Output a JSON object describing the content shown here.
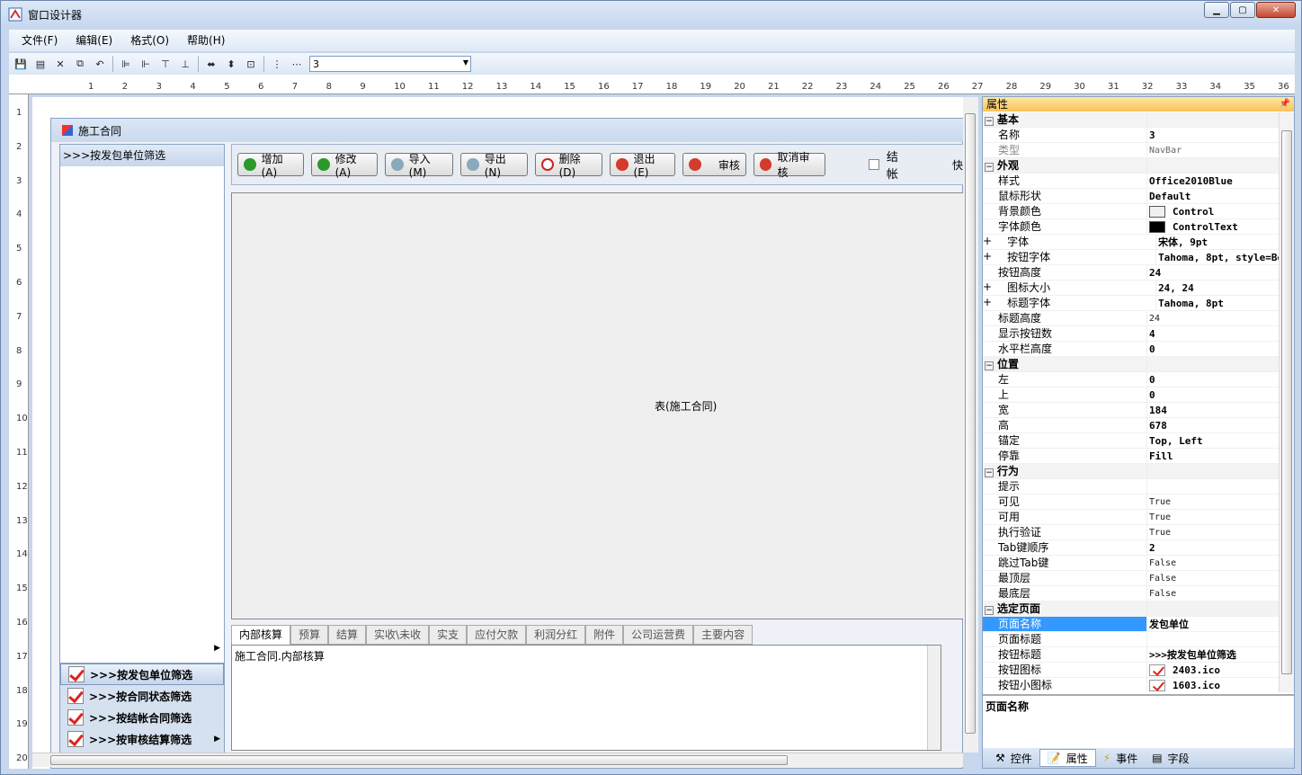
{
  "window": {
    "title": "窗口设计器"
  },
  "menu": [
    "文件(F)",
    "编辑(E)",
    "格式(O)",
    "帮助(H)"
  ],
  "toolbar": {
    "combo_value": "3"
  },
  "ruler": {
    "h": [
      "1",
      "2",
      "3",
      "4",
      "5",
      "6",
      "7",
      "8",
      "9",
      "10",
      "11",
      "12",
      "13",
      "14",
      "15",
      "16",
      "17",
      "18",
      "19",
      "20",
      "21",
      "22",
      "23",
      "24",
      "25",
      "26",
      "27",
      "28",
      "29",
      "30",
      "31",
      "32",
      "33",
      "34",
      "35",
      "36"
    ],
    "v": [
      "1",
      "2",
      "3",
      "4",
      "5",
      "6",
      "7",
      "8",
      "9",
      "10",
      "11",
      "12",
      "13",
      "14",
      "15",
      "16",
      "17",
      "18",
      "19",
      "20"
    ]
  },
  "form": {
    "title": "施工合同",
    "navbar": {
      "header": ">>>按发包单位筛选",
      "buttons": [
        ">>>按发包单位筛选",
        ">>>按合同状态筛选",
        ">>>按结帐合同筛选",
        ">>>按审核结算筛选"
      ]
    },
    "buttons": [
      {
        "label": "增加(A)",
        "icon": "check-icon"
      },
      {
        "label": "修改(A)",
        "icon": "check-icon"
      },
      {
        "label": "导入(M)",
        "icon": "import-icon"
      },
      {
        "label": "导出(N)",
        "icon": "export-icon"
      },
      {
        "label": "删除(D)",
        "icon": "delete-icon"
      },
      {
        "label": "退出(E)",
        "icon": "minus-icon"
      },
      {
        "label": "审核",
        "icon": "minus-icon"
      },
      {
        "label": "取消审核",
        "icon": "minus-icon"
      }
    ],
    "checkbox_label": "结帐",
    "cut_text": "快",
    "grid_label": "表(施工合同)",
    "tabs": [
      "内部核算",
      "预算",
      "结算",
      "实收\\未收",
      "实支",
      "应付欠款",
      "利润分红",
      "附件",
      "公司运营费",
      "主要内容"
    ],
    "tab_content": "施工合同.内部核算"
  },
  "properties": {
    "title": "属性",
    "rows": [
      {
        "cat": "基本"
      },
      {
        "k": "名称",
        "v": "3"
      },
      {
        "k": "类型",
        "v": "NavBar",
        "style": "grey"
      },
      {
        "cat": "外观"
      },
      {
        "k": "样式",
        "v": "Office2010Blue"
      },
      {
        "k": "鼠标形状",
        "v": "Default"
      },
      {
        "k": "背景颜色",
        "v": "Control",
        "swatch": "#f0f0f0"
      },
      {
        "k": "字体颜色",
        "v": "ControlText",
        "swatch": "#000000"
      },
      {
        "k": "字体",
        "v": "宋体, 9pt",
        "plus": true
      },
      {
        "k": "按钮字体",
        "v": "Tahoma, 8pt, style=Bo",
        "plus": true
      },
      {
        "k": "按钮高度",
        "v": "24"
      },
      {
        "k": "图标大小",
        "v": "24, 24",
        "plus": true
      },
      {
        "k": "标题字体",
        "v": "Tahoma, 8pt",
        "plus": true
      },
      {
        "k": "标题高度",
        "v": "24",
        "style": "n"
      },
      {
        "k": "显示按钮数",
        "v": "4"
      },
      {
        "k": "水平栏高度",
        "v": "0"
      },
      {
        "cat": "位置"
      },
      {
        "k": "左",
        "v": "0"
      },
      {
        "k": "上",
        "v": "0"
      },
      {
        "k": "宽",
        "v": "184"
      },
      {
        "k": "高",
        "v": "678"
      },
      {
        "k": "锚定",
        "v": "Top, Left"
      },
      {
        "k": "停靠",
        "v": "Fill"
      },
      {
        "cat": "行为"
      },
      {
        "k": "提示",
        "v": ""
      },
      {
        "k": "可见",
        "v": "True",
        "style": "n"
      },
      {
        "k": "可用",
        "v": "True",
        "style": "n"
      },
      {
        "k": "执行验证",
        "v": "True",
        "style": "n"
      },
      {
        "k": "Tab键顺序",
        "v": "2"
      },
      {
        "k": "跳过Tab键",
        "v": "False",
        "style": "n"
      },
      {
        "k": "最顶层",
        "v": "False",
        "style": "n"
      },
      {
        "k": "最底层",
        "v": "False",
        "style": "n"
      },
      {
        "cat": "选定页面"
      },
      {
        "k": "页面名称",
        "v": "发包单位",
        "selected": true
      },
      {
        "k": "页面标题",
        "v": ""
      },
      {
        "k": "按钮标题",
        "v": ">>>按发包单位筛选"
      },
      {
        "k": "按钮图标",
        "v": "2403.ico",
        "img": true
      },
      {
        "k": "按钮小图标",
        "v": "1603.ico",
        "img": true
      }
    ],
    "description": "页面名称",
    "tabs": [
      {
        "label": "控件",
        "icon": "tools-icon"
      },
      {
        "label": "属性",
        "icon": "properties-icon"
      },
      {
        "label": "事件",
        "icon": "lightning-icon"
      },
      {
        "label": "字段",
        "icon": "fields-icon"
      }
    ]
  }
}
